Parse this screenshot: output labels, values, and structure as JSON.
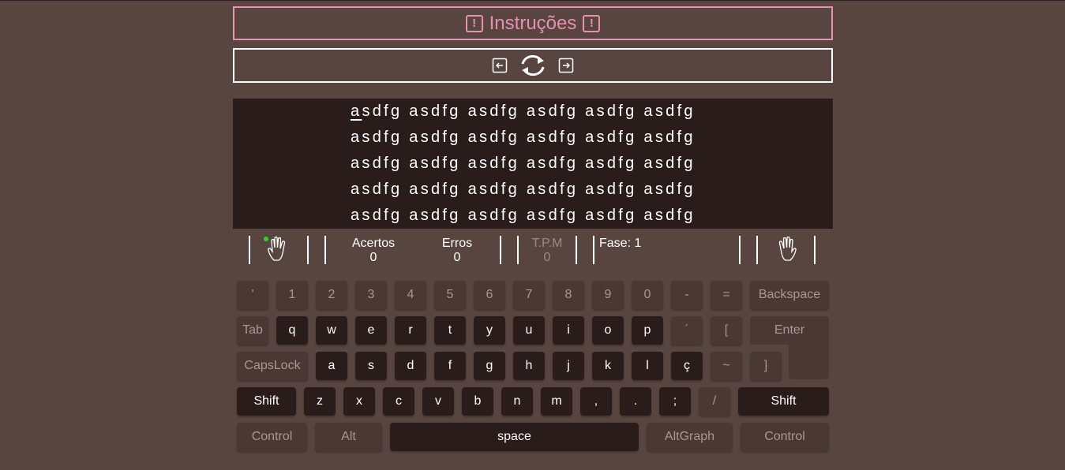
{
  "instructions": {
    "title": "Instruções",
    "icon": "exclamation-icon",
    "color": "#e791b2"
  },
  "controls": {
    "prev_icon": "arrow-left-icon",
    "reload_icon": "refresh-icon",
    "next_icon": "arrow-right-icon"
  },
  "text_lines": [
    "asdfg asdfg asdfg asdfg asdfg asdfg",
    "asdfg asdfg asdfg asdfg asdfg asdfg",
    "asdfg asdfg asdfg asdfg asdfg asdfg",
    "asdfg asdfg asdfg asdfg asdfg asdfg",
    "asdfg asdfg asdfg asdfg asdfg asdfg"
  ],
  "current_char_index": 0,
  "stats": {
    "acertos_label": "Acertos",
    "acertos_value": "0",
    "erros_label": "Erros",
    "erros_value": "0",
    "tpm_label": "T.P.M",
    "tpm_value": "0",
    "fase_text": "Fase: 1"
  },
  "hands": {
    "left_icon": "left-hand-icon",
    "right_icon": "right-hand-icon",
    "active_indicator_color": "#2dd42d"
  },
  "keyboard": {
    "row1": [
      "'",
      "1",
      "2",
      "3",
      "4",
      "5",
      "6",
      "7",
      "8",
      "9",
      "0",
      "-",
      "=",
      "Backspace"
    ],
    "row2": [
      "Tab",
      "q",
      "w",
      "e",
      "r",
      "t",
      "y",
      "u",
      "i",
      "o",
      "p",
      "´",
      "[",
      "Enter"
    ],
    "row3": [
      "CapsLock",
      "a",
      "s",
      "d",
      "f",
      "g",
      "h",
      "j",
      "k",
      "l",
      "ç",
      "~",
      "]"
    ],
    "row4": [
      "Shift",
      "z",
      "x",
      "c",
      "v",
      "b",
      "n",
      "m",
      ",",
      ".",
      ";",
      "/",
      "Shift"
    ],
    "row5": [
      "Control",
      "Alt",
      "space",
      "AltGraph",
      "Control"
    ]
  },
  "colors": {
    "background": "#584540",
    "text_panel": "#2a1c1a",
    "key_light": "#4a3834",
    "key_dark": "#2a1c1a"
  }
}
